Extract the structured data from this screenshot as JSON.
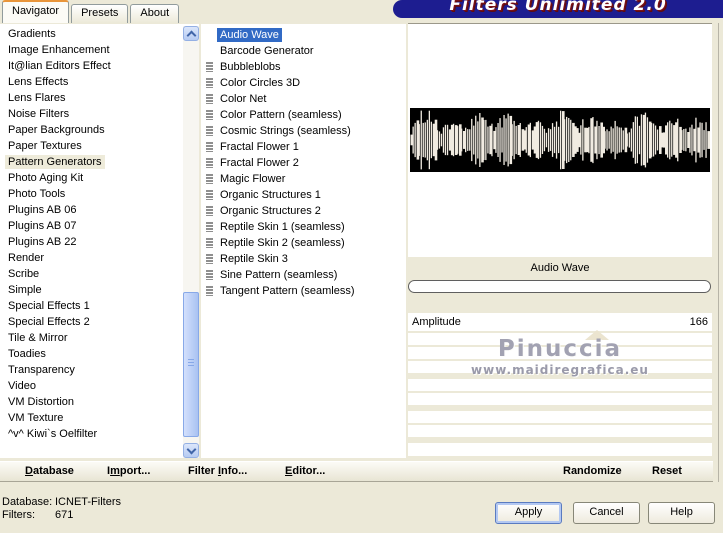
{
  "window": {
    "title": "Filters Unlimited 2.0"
  },
  "tabs": [
    {
      "label": "Navigator",
      "active": true
    },
    {
      "label": "Presets",
      "active": false
    },
    {
      "label": "About",
      "active": false
    }
  ],
  "categories": {
    "selected_index": 8,
    "items": [
      "Gradients",
      "Image Enhancement",
      "It@lian Editors Effect",
      "Lens Effects",
      "Lens Flares",
      "Noise Filters",
      "Paper Backgrounds",
      "Paper Textures",
      "Pattern Generators",
      "Photo Aging Kit",
      "Photo Tools",
      "Plugins AB 06",
      "Plugins AB 07",
      "Plugins AB 22",
      "Render",
      "Scribe",
      "Simple",
      "Special Effects 1",
      "Special Effects 2",
      "Tile & Mirror",
      "Toadies",
      "Transparency",
      "Video",
      "VM Distortion",
      "VM Texture",
      "^v^ Kiwi`s Oelfilter"
    ]
  },
  "filters": {
    "selected_index": 0,
    "items": [
      {
        "label": "Audio Wave",
        "icon": false,
        "selected": true
      },
      {
        "label": "Barcode Generator",
        "icon": false,
        "selected": false
      },
      {
        "label": "Bubbleblobs",
        "icon": true,
        "selected": false
      },
      {
        "label": "Color Circles 3D",
        "icon": true,
        "selected": false
      },
      {
        "label": "Color Net",
        "icon": true,
        "selected": false
      },
      {
        "label": "Color Pattern (seamless)",
        "icon": true,
        "selected": false
      },
      {
        "label": "Cosmic Strings (seamless)",
        "icon": true,
        "selected": false
      },
      {
        "label": "Fractal Flower 1",
        "icon": true,
        "selected": false
      },
      {
        "label": "Fractal Flower 2",
        "icon": true,
        "selected": false
      },
      {
        "label": "Magic Flower",
        "icon": true,
        "selected": false
      },
      {
        "label": "Organic Structures 1",
        "icon": true,
        "selected": false
      },
      {
        "label": "Organic Structures 2",
        "icon": true,
        "selected": false
      },
      {
        "label": "Reptile Skin 1 (seamless)",
        "icon": true,
        "selected": false
      },
      {
        "label": "Reptile Skin 2 (seamless)",
        "icon": true,
        "selected": false
      },
      {
        "label": "Reptile Skin 3",
        "icon": true,
        "selected": false
      },
      {
        "label": "Sine Pattern (seamless)",
        "icon": true,
        "selected": false
      },
      {
        "label": "Tangent Pattern (seamless)",
        "icon": true,
        "selected": false
      }
    ]
  },
  "preview": {
    "caption": "Audio Wave"
  },
  "parameters": [
    {
      "name": "Amplitude",
      "value": "166"
    }
  ],
  "watermark": {
    "line1": "Pinuccia",
    "line2": "www.maidiregrafica.eu"
  },
  "footer_menu": {
    "database": {
      "pre": "",
      "key": "D",
      "post": "atabase"
    },
    "import": {
      "pre": "I",
      "key": "m",
      "post": "port..."
    },
    "filter_info": {
      "pre": "Filter ",
      "key": "I",
      "post": "nfo..."
    },
    "editor": {
      "pre": "",
      "key": "E",
      "post": "ditor..."
    },
    "randomize": "Randomize",
    "reset": "Reset"
  },
  "status": {
    "rows": [
      {
        "label": "Database:",
        "value": "ICNET-Filters"
      },
      {
        "label": "Filters:",
        "value": "671"
      }
    ]
  },
  "actions": [
    {
      "label": "Apply",
      "focused": true
    },
    {
      "label": "Cancel",
      "focused": false
    },
    {
      "label": "Help",
      "focused": false
    }
  ],
  "colors": {
    "selection_blue": "#316ac5",
    "banner_navy": "#1d1d90",
    "tab_accent_orange": "#e9953a",
    "dialog_beige": "#ece9d8"
  }
}
